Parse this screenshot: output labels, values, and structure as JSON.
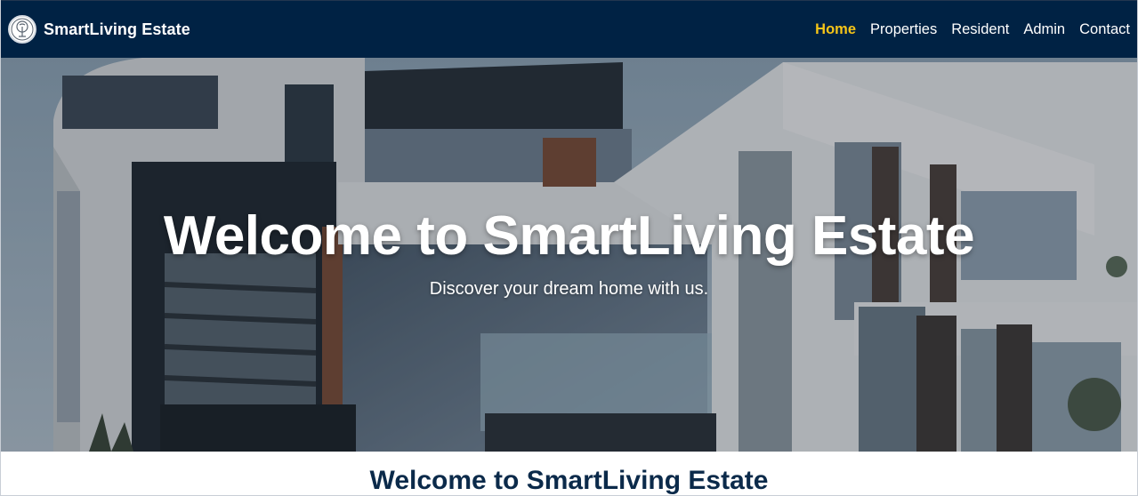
{
  "navbar": {
    "brand": "SmartLiving Estate",
    "links": [
      {
        "label": "Home",
        "active": true
      },
      {
        "label": "Properties",
        "active": false
      },
      {
        "label": "Resident",
        "active": false
      },
      {
        "label": "Admin",
        "active": false
      },
      {
        "label": "Contact",
        "active": false
      }
    ],
    "logo_icon": "tree-logo-icon"
  },
  "hero": {
    "title": "Welcome to SmartLiving Estate",
    "subtitle": "Discover your dream home with us."
  },
  "section": {
    "title": "Welcome to SmartLiving Estate"
  },
  "colors": {
    "nav_bg": "#002244",
    "nav_active": "#f5c518",
    "section_title": "#0b2a4a"
  }
}
